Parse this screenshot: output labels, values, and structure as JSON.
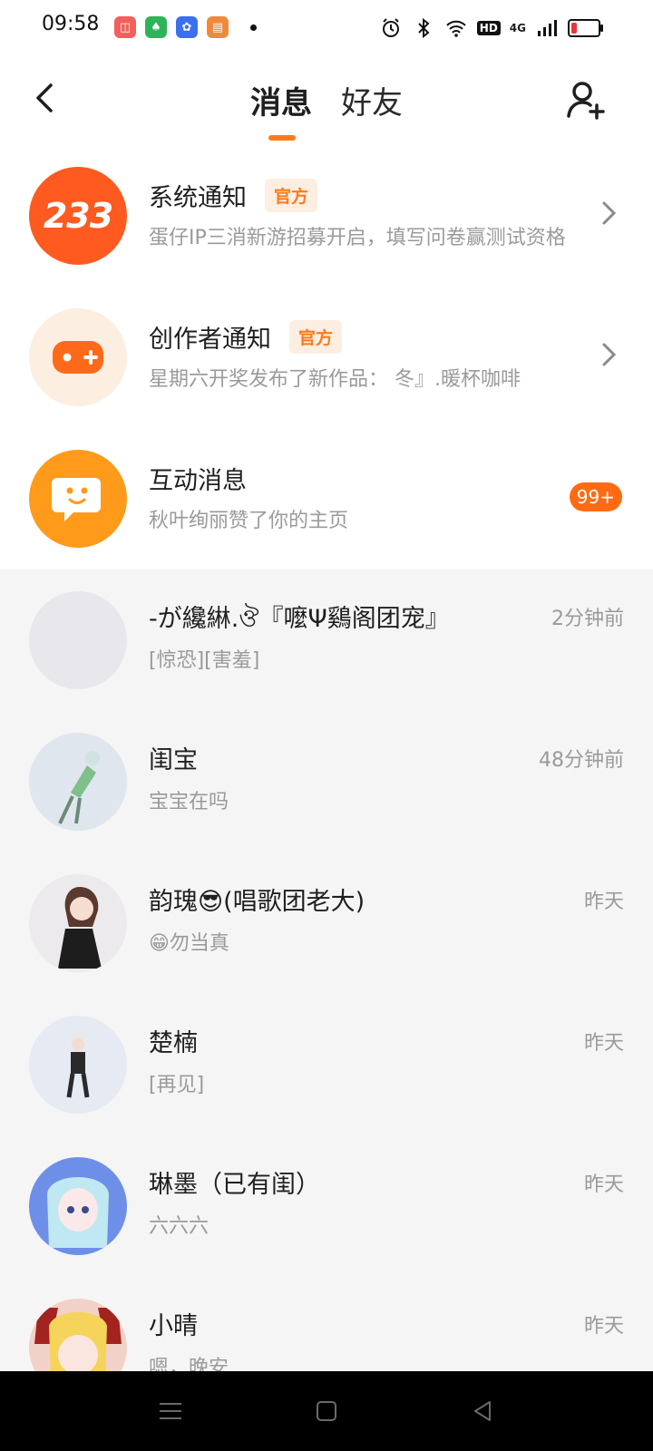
{
  "status_bar": {
    "time": "09:58",
    "right_labels": {
      "hd": "HD",
      "network": "4G"
    }
  },
  "header": {
    "tabs": [
      {
        "label": "消息",
        "active": true
      },
      {
        "label": "好友",
        "active": false
      }
    ]
  },
  "official_items": [
    {
      "title": "系统通知",
      "badge": "官方",
      "subtitle": "蛋仔IP三消新游招募开启，填写问卷赢测试资格",
      "avatar_text": "233",
      "avatar_color": "#ff5a1f"
    },
    {
      "title": "创作者通知",
      "badge": "官方",
      "subtitle": "星期六开奖发布了新作品：  冬』.暖杯咖啡",
      "avatar_color": "#fdeee2"
    },
    {
      "title": "互动消息",
      "subtitle": "秋叶绚丽赞了你的主页",
      "count": "99+",
      "avatar_color": "#ff9a1a"
    }
  ],
  "chats": [
    {
      "name": "-が纔綝.ঔ『嚒Ψ鷄阁团宠』",
      "message": "[惊恐][害羞]",
      "time": "2分钟前"
    },
    {
      "name": "闺宝",
      "message": "宝宝在吗",
      "time": "48分钟前"
    },
    {
      "name": "韵瑰😎(唱歌团老大)",
      "message": "😁勿当真",
      "time": "昨天"
    },
    {
      "name": "楚楠",
      "message": "[再见]",
      "time": "昨天"
    },
    {
      "name": "琳墨（已有闺）",
      "message": "六六六",
      "time": "昨天"
    },
    {
      "name": "小晴",
      "message": "嗯，晚安",
      "time": "昨天"
    }
  ],
  "colors": {
    "accent": "#ff7a1a",
    "badge_bg": "#fdeee2",
    "count_badge": "#ff6a13"
  }
}
